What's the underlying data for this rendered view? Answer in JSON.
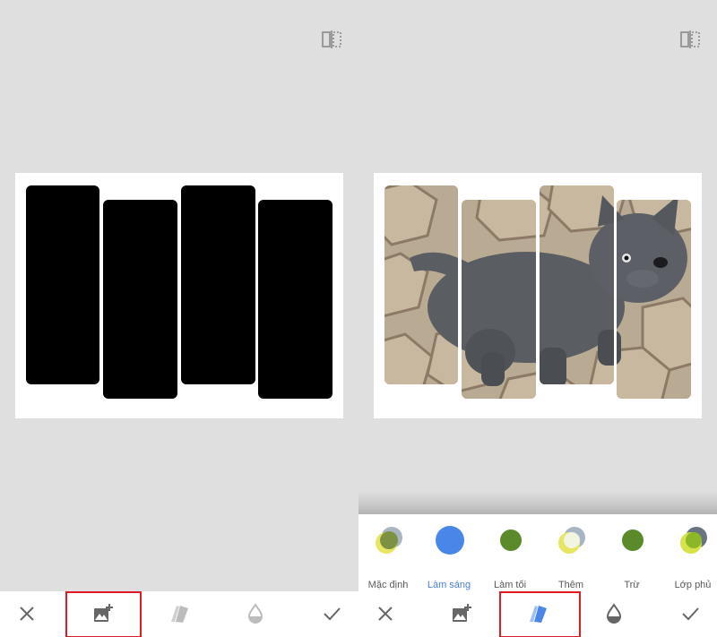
{
  "panels": [
    {
      "id": "left",
      "description_bar": null,
      "toolbar": [
        "close-icon",
        "add-image-icon",
        "blend-mode-icon",
        "opacity-icon",
        "check-icon"
      ],
      "highlighted_tool": "add-image-icon"
    },
    {
      "id": "right",
      "toolbar": [
        "close-icon",
        "add-image-icon",
        "blend-mode-icon",
        "opacity-icon",
        "check-icon"
      ],
      "highlighted_tool": "blend-mode-icon"
    }
  ],
  "blend_modes": [
    {
      "label": "Mặc định",
      "icon": "blend-default-icon"
    },
    {
      "label": "Làm sáng",
      "icon": "blend-lighten-icon",
      "selected": true
    },
    {
      "label": "Làm tối",
      "icon": "blend-darken-icon"
    },
    {
      "label": "Thêm",
      "icon": "blend-add-icon"
    },
    {
      "label": "Trừ",
      "icon": "blend-subtract-icon"
    },
    {
      "label": "Lớp phủ",
      "icon": "blend-overlay-icon"
    }
  ],
  "colors": {
    "background": "#dfdfdf",
    "accent_blue": "#4a86e8",
    "highlight_red": "#e01b24",
    "mask": "#000000",
    "olive": "#5b8a2b"
  }
}
